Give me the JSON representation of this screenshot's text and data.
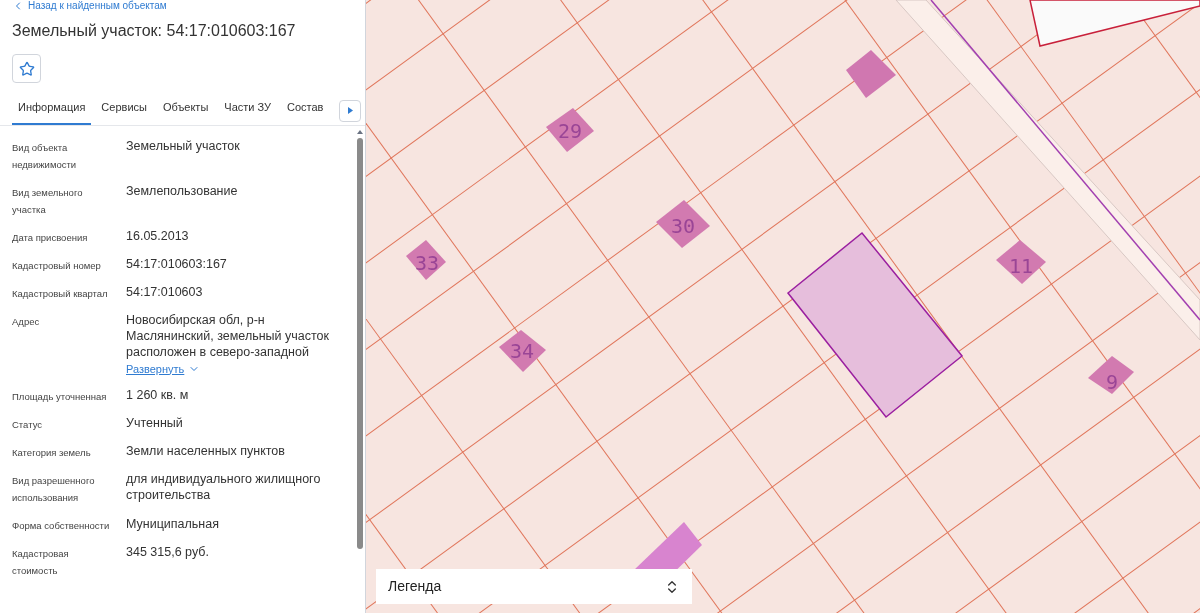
{
  "back_link": "Назад к найденным объектам",
  "title": "Земельный участок: 54:17:010603:167",
  "tabs": [
    {
      "label": "Информация",
      "selected": true
    },
    {
      "label": "Сервисы",
      "selected": false
    },
    {
      "label": "Объекты",
      "selected": false
    },
    {
      "label": "Части ЗУ",
      "selected": false
    },
    {
      "label": "Состав",
      "selected": false
    }
  ],
  "properties": [
    {
      "label": "Вид объекта недвижимости",
      "value": "Земельный участок"
    },
    {
      "label": "Вид земельного участка",
      "value": "Землепользование"
    },
    {
      "label": "Дата присвоения",
      "value": "16.05.2013"
    },
    {
      "label": "Кадастровый номер",
      "value": "54:17:010603:167"
    },
    {
      "label": "Кадастровый квартал",
      "value": "54:17:010603"
    },
    {
      "label": "Адрес",
      "value": "Новосибирская обл, р-н Маслянинский, земельный участок расположен в северо-западной",
      "expand_link": "Развернуть"
    },
    {
      "label": "Площадь уточненная",
      "value": "1 260 кв. м"
    },
    {
      "label": "Статус",
      "value": "Учтенный"
    },
    {
      "label": "Категория земель",
      "value": "Земли населенных пунктов"
    },
    {
      "label": "Вид разрешенного использования",
      "value": "для индивидуального жилищного строительства"
    },
    {
      "label": "Форма собственности",
      "value": "Муниципальная"
    },
    {
      "label": "Кадастровая стоимость",
      "value": "345 315,6 руб."
    }
  ],
  "map": {
    "house_numbers": [
      {
        "label": "29"
      },
      {
        "label": "30"
      },
      {
        "label": "33"
      },
      {
        "label": "34"
      },
      {
        "label": "11"
      },
      {
        "label": "9"
      }
    ],
    "legend": {
      "label": "Легенда"
    }
  }
}
